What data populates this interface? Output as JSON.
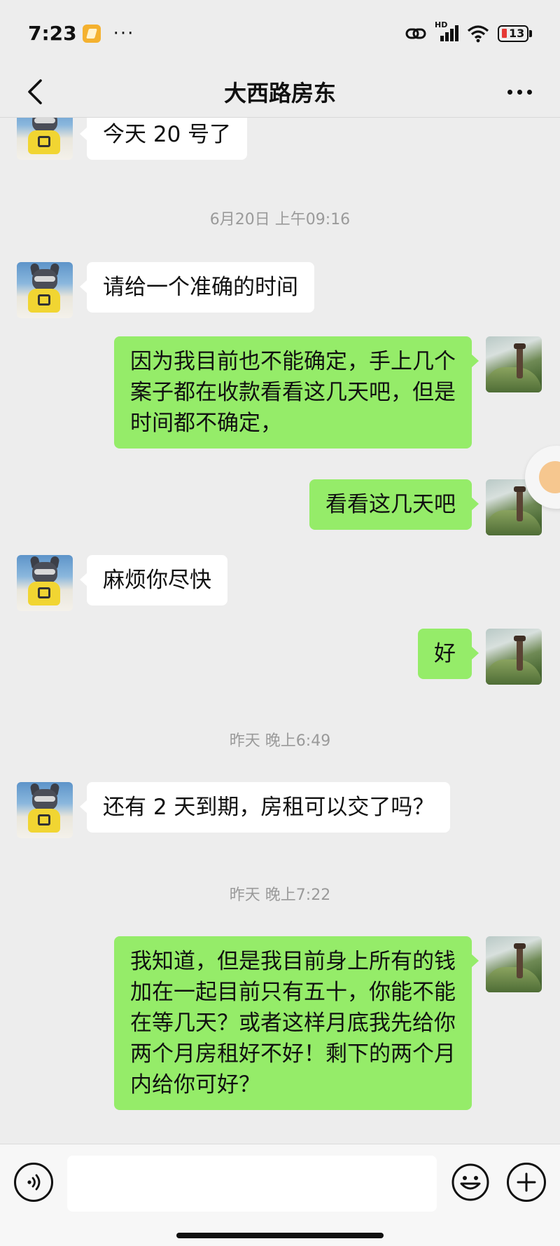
{
  "status_bar": {
    "time": "7:23",
    "more": "···",
    "signal_label": "HD",
    "battery_level": "13",
    "icons": [
      "app-notification-icon",
      "link-icon",
      "signal-icon",
      "wifi-icon",
      "battery-icon"
    ]
  },
  "header": {
    "title": "大西路房东",
    "back_icon": "chevron-left-icon",
    "more_icon": "more-dots-icon"
  },
  "messages": [
    {
      "side": "left",
      "text": "今天 20 号了"
    },
    {
      "type": "timestamp",
      "text": "6月20日 上午09:16"
    },
    {
      "side": "left",
      "text": "请给一个准确的时间"
    },
    {
      "side": "right",
      "text": "因为我目前也不能确定，手上几个\n案子都在收款看看这几天吧，但是\n时间都不确定，"
    },
    {
      "side": "right",
      "text": "看看这几天吧"
    },
    {
      "side": "left",
      "text": "麻烦你尽快"
    },
    {
      "side": "right",
      "text": "好"
    },
    {
      "type": "timestamp",
      "text": "昨天 晚上6:49"
    },
    {
      "side": "left",
      "text": "还有 2 天到期，房租可以交了吗？"
    },
    {
      "type": "timestamp",
      "text": "昨天 晚上7:22"
    },
    {
      "side": "right",
      "text": "我知道，但是我目前身上所有的钱\n加在一起目前只有五十，你能不能\n在等几天？或者这样月底我先给你\n两个月房租好不好！剩下的两个月\n内给你可好？"
    }
  ],
  "input_bar": {
    "input_value": "",
    "input_placeholder": "",
    "voice_icon": "voice-icon",
    "emoji_icon": "emoji-icon",
    "plus_icon": "plus-icon"
  },
  "colors": {
    "background": "#ededed",
    "bubble_self": "#95ec69",
    "bubble_other": "#ffffff",
    "timestamp": "#9a9a9a"
  }
}
